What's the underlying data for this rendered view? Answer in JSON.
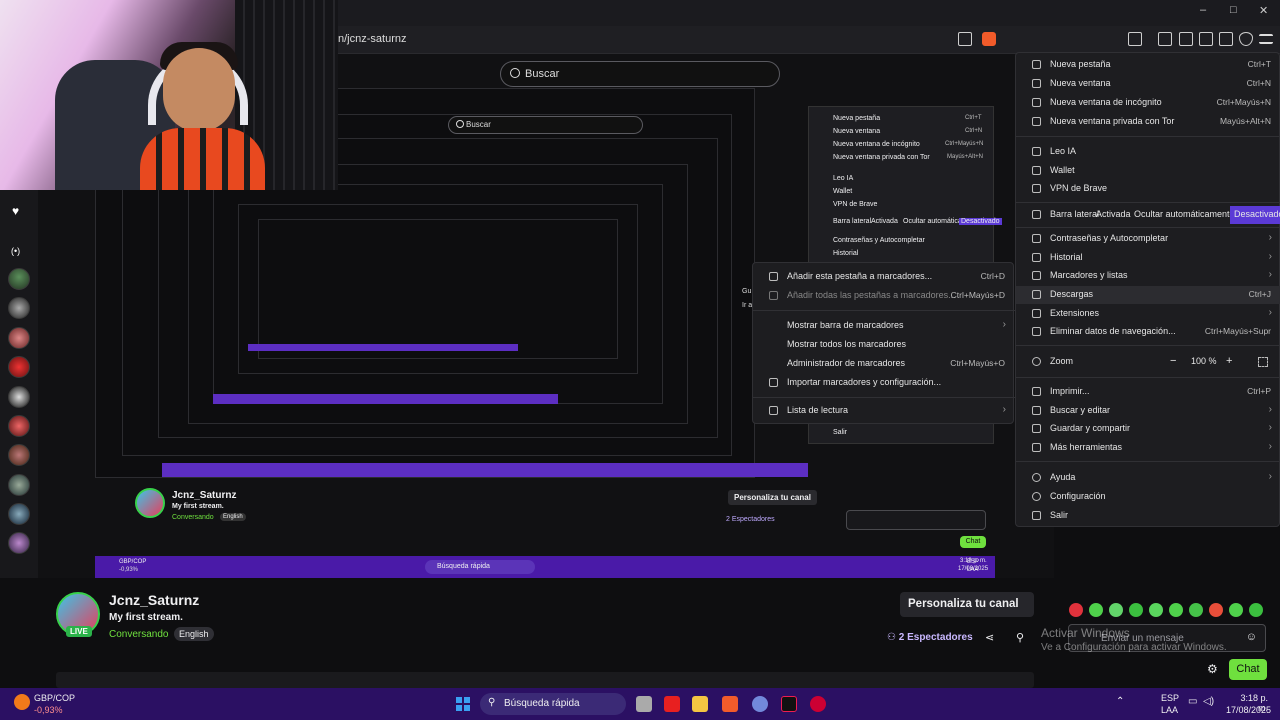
{
  "browser": {
    "url": "n/jcnz-saturnz",
    "search_placeholder": "Buscar"
  },
  "window_controls": [
    "–",
    "□",
    "✕"
  ],
  "menu": {
    "items": [
      {
        "label": "Nueva pestaña",
        "shortcut": "Ctrl+T",
        "icon": "new-tab-icon"
      },
      {
        "label": "Nueva ventana",
        "shortcut": "Ctrl+N",
        "icon": "new-window-icon"
      },
      {
        "label": "Nueva ventana de incógnito",
        "shortcut": "Ctrl+Mayús+N",
        "icon": "incognito-icon"
      },
      {
        "label": "Nueva ventana privada con Tor",
        "shortcut": "Mayús+Alt+N",
        "icon": "tor-icon"
      },
      {
        "label": "Leo IA",
        "shortcut": "",
        "icon": "leo-icon"
      },
      {
        "label": "Wallet",
        "shortcut": "",
        "icon": "wallet-icon"
      },
      {
        "label": "VPN de Brave",
        "shortcut": "",
        "icon": "vpn-icon"
      }
    ],
    "sidebar": {
      "label": "Barra lateral",
      "opt1": "Activada",
      "opt2": "Ocultar automáticamente",
      "opt3": "Desactivado"
    },
    "items2": [
      {
        "label": "Contraseñas y Autocompletar",
        "shortcut": "",
        "arrow": "›"
      },
      {
        "label": "Historial",
        "shortcut": "",
        "arrow": "›"
      },
      {
        "label": "Marcadores y listas",
        "shortcut": "",
        "arrow": "›"
      },
      {
        "label": "Descargas",
        "shortcut": "Ctrl+J",
        "arrow": ""
      },
      {
        "label": "Extensiones",
        "shortcut": "",
        "arrow": "›"
      },
      {
        "label": "Eliminar datos de navegación...",
        "shortcut": "Ctrl+Mayús+Supr",
        "arrow": ""
      }
    ],
    "zoom": {
      "label": "Zoom",
      "minus": "−",
      "value": "100 %",
      "plus": "+"
    },
    "items3": [
      {
        "label": "Imprimir...",
        "shortcut": "Ctrl+P",
        "arrow": ""
      },
      {
        "label": "Buscar y editar",
        "shortcut": "",
        "arrow": "›"
      },
      {
        "label": "Guardar y compartir",
        "shortcut": "",
        "arrow": "›"
      },
      {
        "label": "Más herramientas",
        "shortcut": "",
        "arrow": "›"
      }
    ],
    "items4": [
      {
        "label": "Ayuda",
        "arrow": "›"
      },
      {
        "label": "Configuración",
        "arrow": ""
      },
      {
        "label": "Salir",
        "arrow": ""
      }
    ]
  },
  "submenu": {
    "items": [
      {
        "label": "Añadir esta pestaña a marcadores...",
        "shortcut": "Ctrl+D"
      },
      {
        "label": "Añadir todas las pestañas a marcadores...",
        "shortcut": "Ctrl+Mayús+D"
      }
    ],
    "items2": [
      {
        "label": "Mostrar barra de marcadores",
        "shortcut": "",
        "arrow": "›"
      },
      {
        "label": "Mostrar todos los marcadores",
        "shortcut": "",
        "arrow": ""
      },
      {
        "label": "Administrador de marcadores",
        "shortcut": "Ctrl+Mayús+O",
        "arrow": ""
      },
      {
        "label": "Importar marcadores y configuración...",
        "shortcut": "",
        "arrow": ""
      }
    ],
    "reading": {
      "label": "Lista de lectura",
      "arrow": "›"
    }
  },
  "nested": {
    "name": "Jcnz_Saturnz",
    "title": "My first stream.",
    "category": "Conversando",
    "lang": "English",
    "personaliza": "Personaliza tu canal",
    "viewers": "2 Espectadores"
  },
  "nested_menu_labels": [
    "Nueva pestaña",
    "Nueva ventana",
    "Nueva ventana de incógnito",
    "Nueva ventana privada con Tor",
    "Leo IA",
    "Wallet",
    "VPN de Brave",
    "Barra lateral",
    "Contraseñas y Autocompletar",
    "Historial"
  ],
  "nested_menu_extra": [
    "Activada",
    "Ocultar automáticamente",
    "Desactivado",
    "Salir"
  ],
  "nested_menu_shortcuts": [
    "Ctrl+T",
    "Ctrl+N",
    "Ctrl+Mayús+N",
    "Mayús+Alt+N"
  ],
  "nested_sub_partial": [
    "Gu",
    "Ir a"
  ],
  "stream": {
    "name": "Jcnz_Saturnz",
    "title": "My first stream.",
    "category": "Conversando",
    "lang": "English",
    "live": "LIVE",
    "personaliza": "Personaliza tu canal",
    "viewers_count": "2",
    "viewers_label": "Espectadores"
  },
  "chat": {
    "placeholder": "Enviar un mensaje",
    "button": "Chat"
  },
  "watermark": {
    "line1": "Activar Windows",
    "line2": "Ve a Configuración para activar Windows."
  },
  "taskbar": {
    "stock_name": "GBP/COP",
    "stock_change": "-0,93%",
    "search": "Búsqueda rápida",
    "lang1": "ESP",
    "lang2": "LAA",
    "time": "3:18 p. m.",
    "date": "17/08/2025"
  },
  "nested_taskbar": {
    "search": "Búsqueda rápida",
    "lang1": "ESP",
    "lang2": "LAA",
    "time": "3:18 p. m.",
    "date": "17/08/2025",
    "stock_name": "GBP/COP",
    "stock_change": "-0,93%"
  },
  "colors": {
    "accent": "#7c3aed",
    "twitch_live": "#2bb34a",
    "chat_btn": "#6fe03e",
    "taskbar": "#2b1063",
    "menu_bg": "#1d1d20",
    "selected": "#5b3ad6"
  }
}
